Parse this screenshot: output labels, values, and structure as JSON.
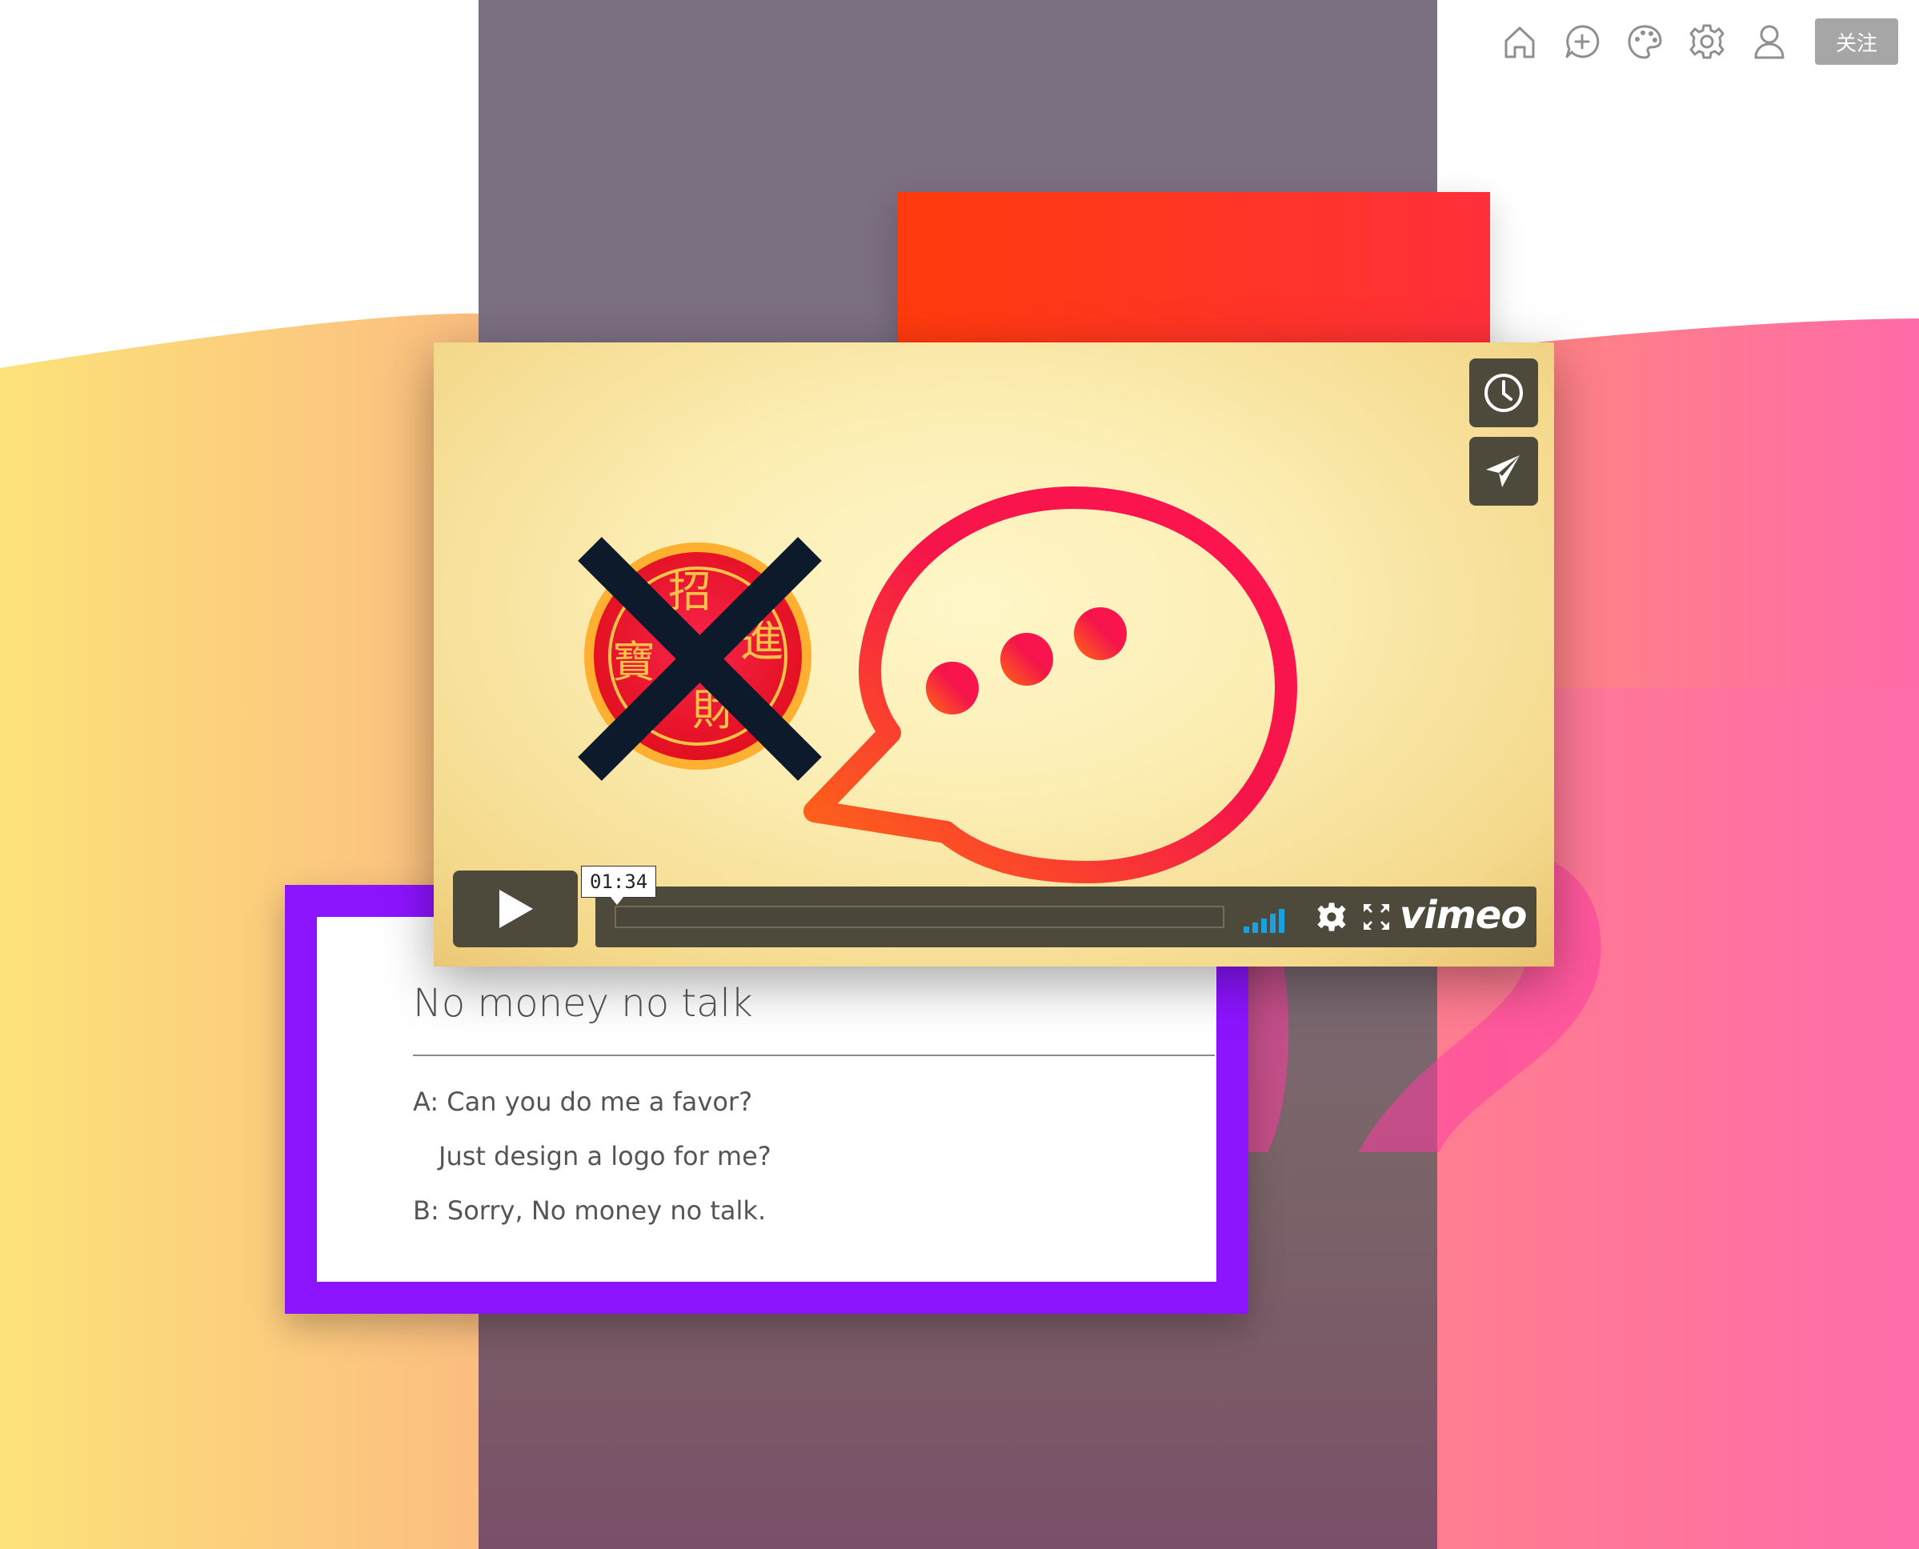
{
  "toolbar": {
    "icons": [
      "home-icon",
      "add-chat-icon",
      "palette-icon",
      "gear-icon",
      "user-icon"
    ],
    "follow_label": "关注"
  },
  "card": {
    "title": "No money no talk",
    "lines": [
      "A: Can you do me a favor?",
      "Just design a logo for me?",
      "B: Sorry, No money no talk."
    ]
  },
  "section_number": "02",
  "video": {
    "time": "01:34",
    "brand": "vimeo",
    "progress": 0,
    "buttons": [
      "clock-icon",
      "send-icon"
    ],
    "stamp_characters": [
      "招",
      "進",
      "寶",
      "財"
    ]
  },
  "colors": {
    "card_frame": "#8c14ff",
    "player_controls": "#4d4a3c",
    "volume_bars": "#1aa0e0",
    "red_block": "#ff3b0c",
    "follow_button": "#a6a6a6"
  }
}
